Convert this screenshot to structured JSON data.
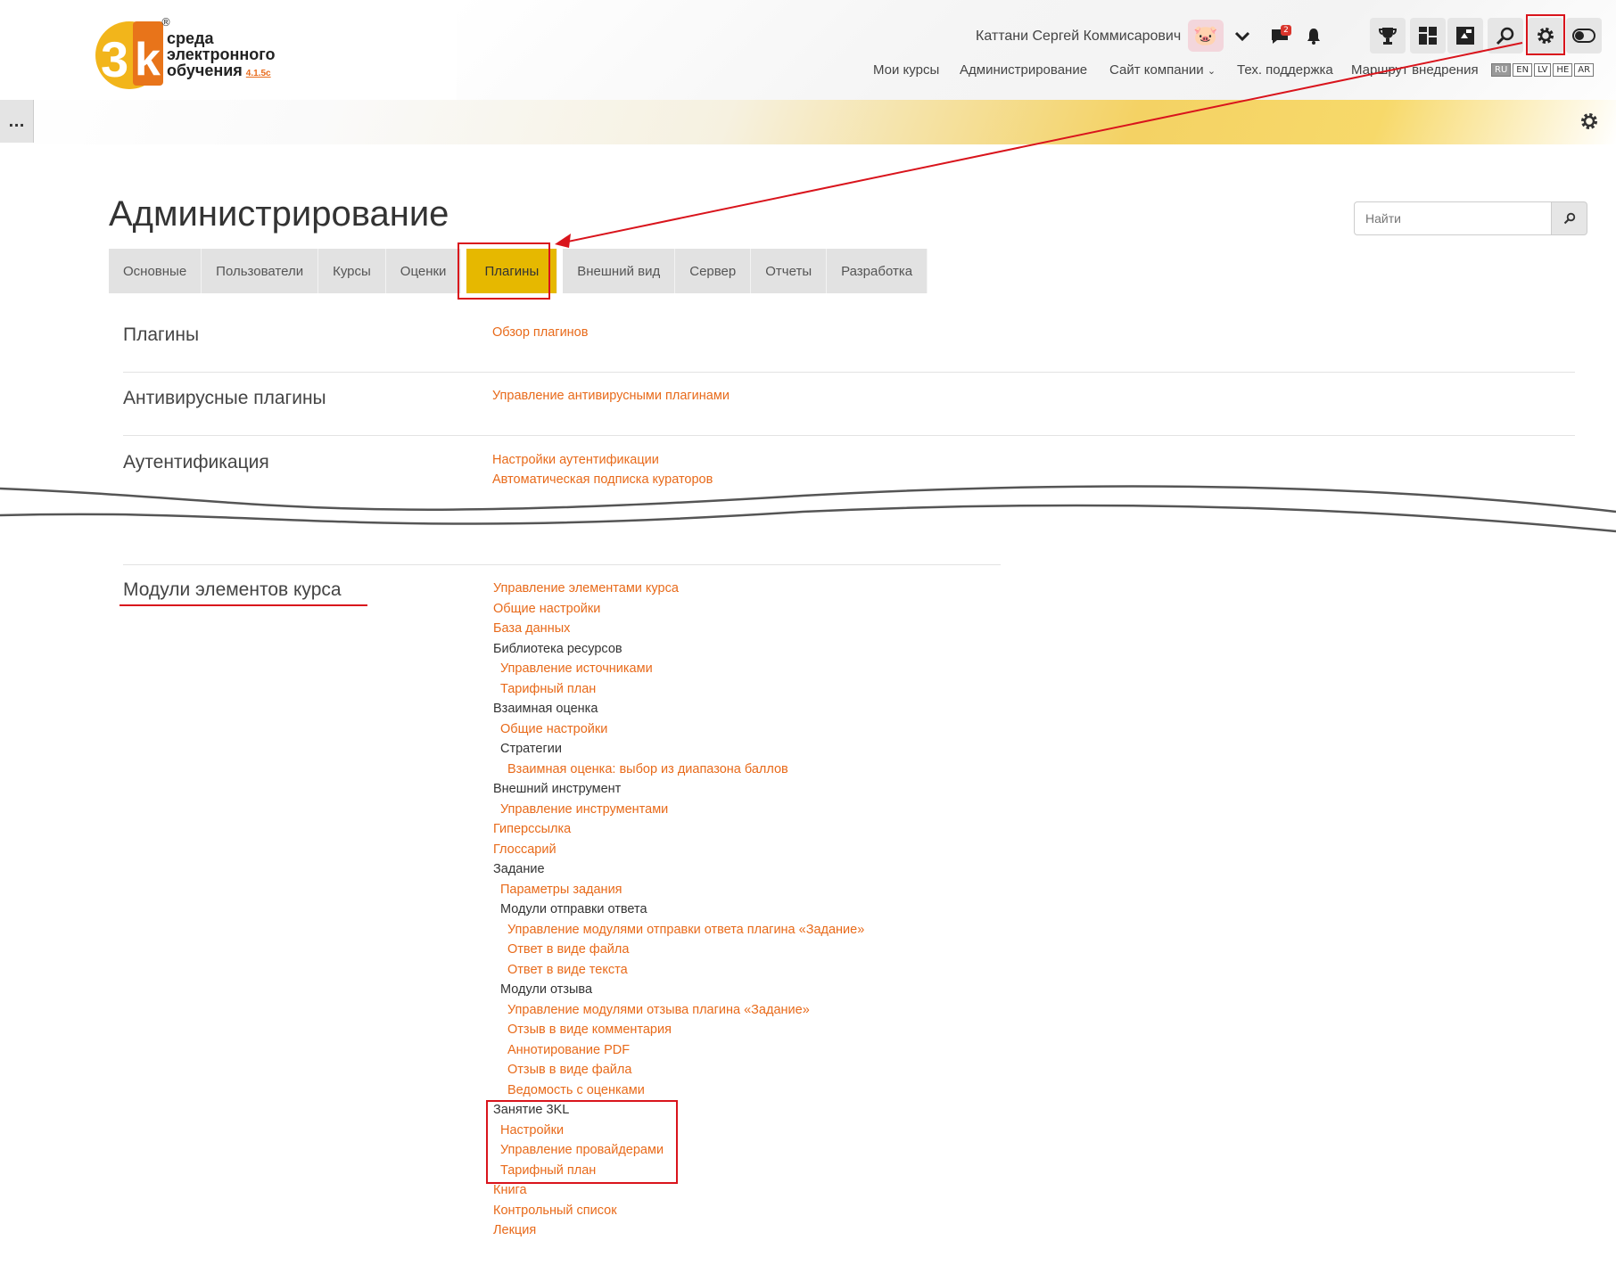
{
  "logo": {
    "line1": "среда",
    "line2": "электронного",
    "line3": "обучения",
    "version": "4.1.5c",
    "reg": "®"
  },
  "user": {
    "name": "Каттани Сергей Коммисарович",
    "message_count": "2"
  },
  "topnav": [
    "Мои курсы",
    "Администрирование",
    "Сайт компании",
    "Тех. поддержка",
    "Маршрут внедрения"
  ],
  "languages": [
    "RU",
    "EN",
    "LV",
    "HE",
    "AR"
  ],
  "banner": {
    "side_label": "..."
  },
  "page": {
    "title": "Администрирование",
    "search_placeholder": "Найти"
  },
  "tabs": [
    "Основные",
    "Пользователи",
    "Курсы",
    "Оценки",
    "Плагины",
    "Внешний вид",
    "Сервер",
    "Отчеты",
    "Разработка"
  ],
  "sections": [
    {
      "title": "Плагины",
      "links": [
        "Обзор плагинов"
      ]
    },
    {
      "title": "Антивирусные плагины",
      "links": [
        "Управление антивирусными плагинами"
      ]
    },
    {
      "title": "Аутентификация",
      "links": [
        "Настройки аутентификации",
        "Автоматическая подписка кураторов"
      ]
    },
    {
      "title": "Модули элементов курса"
    }
  ],
  "modules": [
    "Управление элементами курса",
    "Общие настройки",
    "База данных",
    "Библиотека ресурсов",
    "Управление источниками",
    "Тарифный план",
    "Взаимная оценка",
    "Общие настройки",
    "Стратегии",
    "Взаимная оценка: выбор из диапазона баллов",
    "Внешний инструмент",
    "Управление инструментами",
    "Гиперссылка",
    "Глоссарий",
    "Задание",
    "Параметры задания",
    "Модули отправки ответа",
    "Управление модулями отправки ответа плагина «Задание»",
    "Ответ в виде файла",
    "Ответ в виде текста",
    "Модули отзыва",
    "Управление модулями отзыва плагина «Задание»",
    "Отзыв в виде комментария",
    "Аннотирование PDF",
    "Отзыв в виде файла",
    "Ведомость с оценками",
    "Занятие 3KL",
    "Настройки",
    "Управление провайдерами",
    "Тарифный план",
    "Книга",
    "Контрольный список",
    "Лекция"
  ]
}
